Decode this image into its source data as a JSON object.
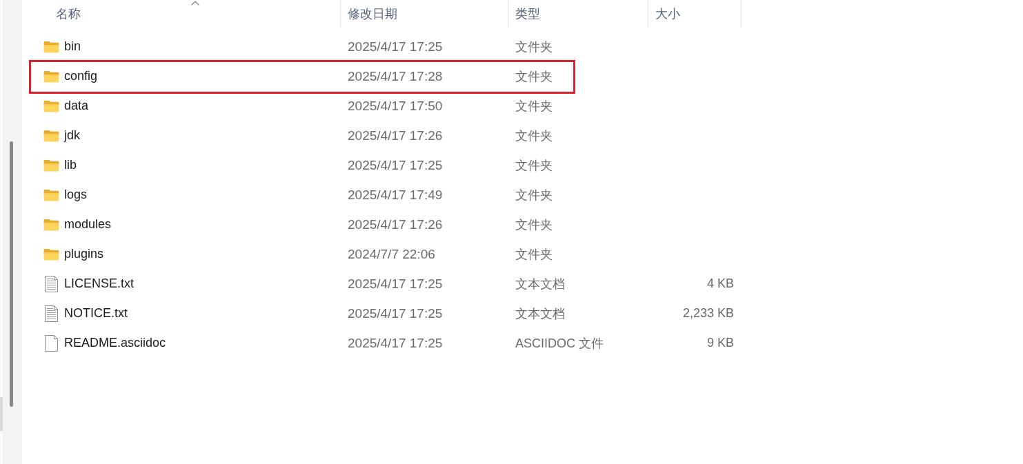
{
  "columns": [
    {
      "label": "名称",
      "sorted": true
    },
    {
      "label": "修改日期",
      "sorted": false
    },
    {
      "label": "类型",
      "sorted": false
    },
    {
      "label": "大小",
      "sorted": false
    }
  ],
  "files": [
    {
      "kind": "folder",
      "name": "bin",
      "modified": "2025/4/17 17:25",
      "type": "文件夹",
      "highlighted": false
    },
    {
      "kind": "folder",
      "name": "config",
      "modified": "2025/4/17 17:28",
      "type": "文件夹",
      "highlighted": true
    },
    {
      "kind": "folder",
      "name": "data",
      "modified": "2025/4/17 17:50",
      "type": "文件夹",
      "highlighted": false
    },
    {
      "kind": "folder",
      "name": "jdk",
      "modified": "2025/4/17 17:26",
      "type": "文件夹",
      "highlighted": false
    },
    {
      "kind": "folder",
      "name": "lib",
      "modified": "2025/4/17 17:25",
      "type": "文件夹",
      "highlighted": false
    },
    {
      "kind": "folder",
      "name": "logs",
      "modified": "2025/4/17 17:49",
      "type": "文件夹",
      "highlighted": false
    },
    {
      "kind": "folder",
      "name": "modules",
      "modified": "2025/4/17 17:26",
      "type": "文件夹",
      "highlighted": false
    },
    {
      "kind": "folder",
      "name": "plugins",
      "modified": "2024/7/7 22:06",
      "type": "文件夹",
      "highlighted": false
    },
    {
      "kind": "text",
      "name": "LICENSE.txt",
      "modified": "2025/4/17 17:25",
      "type": "文本文档",
      "size": "4 KB",
      "highlighted": false
    },
    {
      "kind": "text",
      "name": "NOTICE.txt",
      "modified": "2025/4/17 17:25",
      "type": "文本文档",
      "size": "2,233 KB",
      "highlighted": false
    },
    {
      "kind": "file",
      "name": "README.asciidoc",
      "modified": "2025/4/17 17:25",
      "type": "ASCIIDOC 文件",
      "size": "9 KB",
      "highlighted": false
    }
  ]
}
